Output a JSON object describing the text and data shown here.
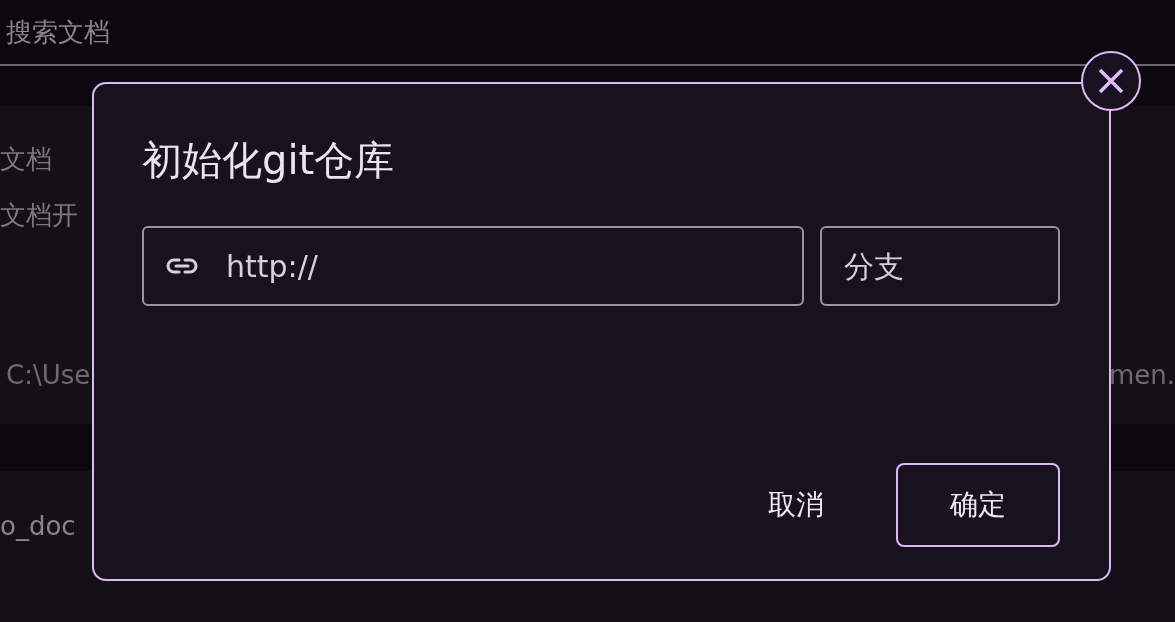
{
  "search": {
    "placeholder": "搜索文档"
  },
  "background": {
    "left_items": [
      "文档",
      "文档开"
    ],
    "path_left": "C:\\Use",
    "path_right": "men.",
    "repo_name": "o_doc"
  },
  "dialog": {
    "title": "初始化git仓库",
    "url_field": {
      "placeholder": "http://"
    },
    "branch_field": {
      "placeholder": "分支"
    },
    "buttons": [
      {
        "label": "取消",
        "kind": "text"
      },
      {
        "label": "确定",
        "kind": "outlined"
      }
    ]
  }
}
